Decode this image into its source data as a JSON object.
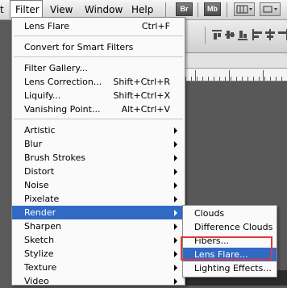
{
  "menubar": {
    "items": [
      "t",
      "Filter",
      "View",
      "Window",
      "Help"
    ],
    "app_buttons": [
      "Br",
      "Mb"
    ]
  },
  "filter_menu": {
    "last_filter": {
      "label": "Lens Flare",
      "shortcut": "Ctrl+F"
    },
    "convert": {
      "label": "Convert for Smart Filters"
    },
    "group1": [
      {
        "label": "Filter Gallery...",
        "shortcut": ""
      },
      {
        "label": "Lens Correction...",
        "shortcut": "Shift+Ctrl+R"
      },
      {
        "label": "Liquify...",
        "shortcut": "Shift+Ctrl+X"
      },
      {
        "label": "Vanishing Point...",
        "shortcut": "Alt+Ctrl+V"
      }
    ],
    "submenus": [
      "Artistic",
      "Blur",
      "Brush Strokes",
      "Distort",
      "Noise",
      "Pixelate",
      "Render",
      "Sharpen",
      "Sketch",
      "Stylize",
      "Texture",
      "Video"
    ],
    "highlighted": "Render"
  },
  "render_submenu": {
    "items": [
      "Clouds",
      "Difference Clouds",
      "Fibers...",
      "Lens Flare...",
      "Lighting Effects..."
    ],
    "highlighted": "Lens Flare..."
  },
  "colors": {
    "highlight": "#316ac5",
    "annotation_box": "#e03a3a"
  }
}
